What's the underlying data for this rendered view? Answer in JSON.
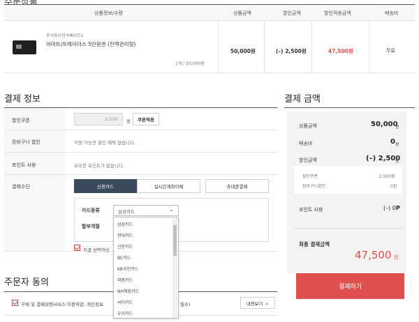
{
  "product_section": {
    "headers": [
      "상품정보/수량",
      "상품금액",
      "할인금액",
      "할인적용금액",
      "배송비"
    ],
    "item": {
      "brand": "주식회사한국페이즈1",
      "name": "이마트/트레이더스 5만원권 (잔액관리형)",
      "qty_price": "1개 / 50,000원",
      "price": "50,000원",
      "discount": "(–) 2,500원",
      "discounted_price": "47,500원",
      "shipping": "무료"
    }
  },
  "payment_info": {
    "title": "결제 정보",
    "coupon_label": "할인쿠폰",
    "coupon_value": "2,500",
    "coupon_unit": "원",
    "coupon_button": "쿠폰적용",
    "cart_discount_label": "장바구니 할인",
    "cart_discount_text": "적용 가능한 할인 혜택 없습니다.",
    "points_label": "포인트 사용",
    "points_text": "보유한 포인트가 없습니다.",
    "method_label": "결제수단",
    "methods": [
      "신용카드",
      "실시간계좌이체",
      "휴대폰결제"
    ],
    "card_type_label": "카드종류",
    "card_type_value": "삼성카드",
    "installment_label": "할부개월",
    "save_checkbox_text": "지금 선택하신",
    "card_options": [
      "삼성카드",
      "현대카드",
      "신한카드",
      "BC카드",
      "KB국민카드",
      "외환카드",
      "NH채움카드",
      "씨티카드",
      "우리카드"
    ]
  },
  "summary": {
    "title": "결제 금액",
    "product_label": "상품금액",
    "product_value": "50,000",
    "product_unit": "원",
    "shipping_label": "배송비",
    "shipping_value": "0",
    "shipping_unit": "원",
    "discount_label": "할인금액",
    "discount_value": "(–) 2,500",
    "discount_unit": "원",
    "coupon_sub_label": "할인쿠폰",
    "coupon_sub_value": "2,500원",
    "cart_sub_label": "장바구니할인",
    "cart_sub_value": "0원",
    "points_label": "포인트 사용",
    "points_value": "(–) 0",
    "points_unit": "P",
    "final_label": "최종 결제금액",
    "final_value": "47,500",
    "final_unit": "원",
    "pay_button": "결제하기"
  },
  "agreement": {
    "title": "주문자 동의",
    "text": "구매 및 결제대행서비스 이용약관, 개인정보",
    "text_tail": "필수)",
    "view_button": "내용보기"
  },
  "colors": {
    "accent_red": "#e0504f",
    "active_method": "#3a4a5c",
    "summary_bg": "#f3f3f3"
  }
}
